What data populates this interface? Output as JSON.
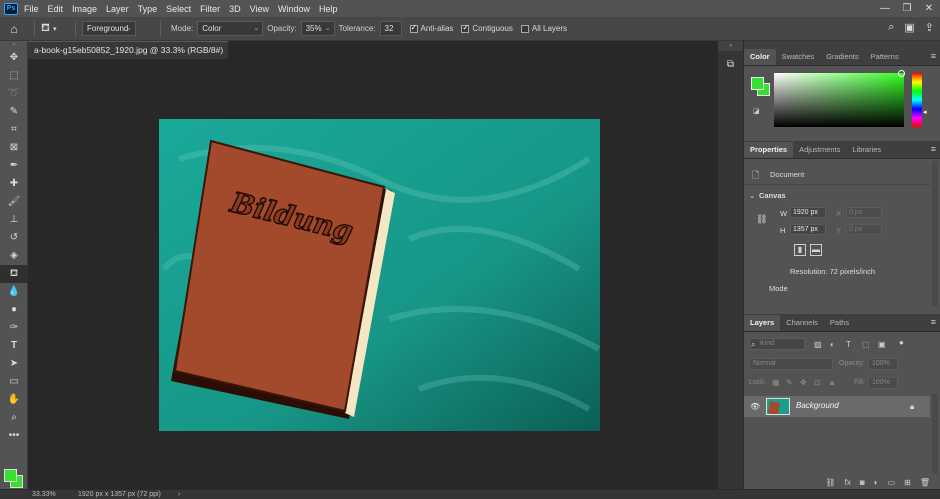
{
  "app": {
    "logo": "Ps",
    "menu": [
      "File",
      "Edit",
      "Image",
      "Layer",
      "Type",
      "Select",
      "Filter",
      "3D",
      "View",
      "Window",
      "Help"
    ],
    "window_controls": [
      "minimize-icon",
      "maximize-icon",
      "close-icon"
    ]
  },
  "options": {
    "fill_source": "Foreground",
    "mode_label": "Mode:",
    "mode_value": "Color",
    "opacity_label": "Opacity:",
    "opacity_value": "35%",
    "tolerance_label": "Tolerance:",
    "tolerance_value": "32",
    "anti_alias": {
      "label": "Anti-alias",
      "checked": true
    },
    "contiguous": {
      "label": "Contiguous",
      "checked": true
    },
    "all_layers": {
      "label": "All Layers",
      "checked": false
    }
  },
  "document": {
    "tab_title": "a-book-g15eb50852_1920.jpg @ 33.3% (RGB/8#) *",
    "image_text": "Bildung",
    "colors": {
      "board": "#1a9e8e",
      "book": "#a34a2c",
      "pages": "#f5e6c4"
    }
  },
  "status": {
    "zoom": "33.33%",
    "doc_info": "1920 px x 1357 px (72 ppi)",
    "arrow": "›"
  },
  "color_panel": {
    "tabs": [
      "Color",
      "Swatches",
      "Gradients",
      "Patterns"
    ],
    "active_tab": "Color",
    "foreground": "#35e02f",
    "background": "#35e02f"
  },
  "properties_panel": {
    "tabs": [
      "Properties",
      "Adjustments",
      "Libraries"
    ],
    "active_tab": "Properties",
    "doc_label": "Document",
    "section": "Canvas",
    "w_label": "W",
    "w_value": "1920 px",
    "h_label": "H",
    "h_value": "1357 px",
    "x_label": "X",
    "x_value": "0 px",
    "y_label": "Y",
    "y_value": "0 px",
    "resolution": "Resolution: 72 pixels/inch",
    "mode_label": "Mode"
  },
  "layers_panel": {
    "tabs": [
      "Layers",
      "Channels",
      "Paths"
    ],
    "active_tab": "Layers",
    "search_placeholder": "Kind",
    "blend_mode": "Normal",
    "opacity_label": "Opacity:",
    "opacity_value": "100%",
    "lock_label": "Lock:",
    "fill_label": "Fill:",
    "fill_value": "100%",
    "layers": [
      {
        "name": "Background",
        "visible": true,
        "locked": true
      }
    ]
  }
}
